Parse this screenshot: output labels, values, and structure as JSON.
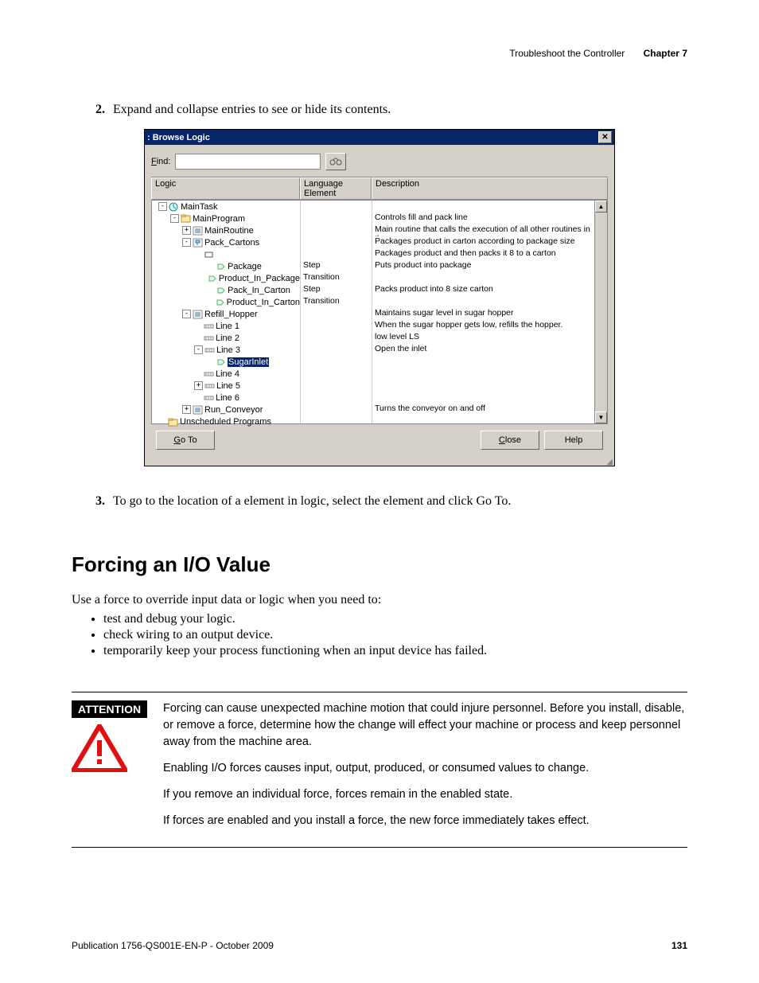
{
  "header": {
    "section": "Troubleshoot the Controller",
    "chapter": "Chapter 7"
  },
  "steps": {
    "s2_num": "2.",
    "s2_text": "Expand and collapse entries to see or hide its contents.",
    "s3_num": "3.",
    "s3_text": "To go to the location of a element in logic, select the element and click Go To."
  },
  "dialog": {
    "title": " : Browse Logic",
    "find_label": "Find:",
    "binoc_alt": "Find",
    "headers": {
      "logic": "Logic",
      "lang": "Language Element",
      "desc": "Description"
    },
    "rows": [
      {
        "indent": 0,
        "exp": "-",
        "icon": "task",
        "label": "MainTask",
        "lang": "",
        "desc": ""
      },
      {
        "indent": 1,
        "exp": "-",
        "icon": "prog",
        "label": "MainProgram",
        "lang": "",
        "desc": "Controls fill and pack line"
      },
      {
        "indent": 2,
        "exp": "+",
        "icon": "routine",
        "label": "MainRoutine",
        "lang": "",
        "desc": "Main routine that calls the execution of all other routines in th"
      },
      {
        "indent": 2,
        "exp": "-",
        "icon": "sfc",
        "label": "Pack_Cartons",
        "lang": "",
        "desc": "Packages product in carton according to package size"
      },
      {
        "indent": 3,
        "exp": "",
        "icon": "sfcbox",
        "label": "",
        "lang": "",
        "desc": "Packages product and then packs it 8 to a carton"
      },
      {
        "indent": 4,
        "exp": "",
        "icon": "step",
        "label": "Package",
        "lang": "Step",
        "desc": "Puts product into package"
      },
      {
        "indent": 4,
        "exp": "",
        "icon": "step",
        "label": "Product_In_Package",
        "lang": "Transition",
        "desc": ""
      },
      {
        "indent": 4,
        "exp": "",
        "icon": "step",
        "label": "Pack_In_Carton",
        "lang": "Step",
        "desc": "Packs product into 8 size carton"
      },
      {
        "indent": 4,
        "exp": "",
        "icon": "step",
        "label": "Product_In_Carton",
        "lang": "Transition",
        "desc": ""
      },
      {
        "indent": 2,
        "exp": "-",
        "icon": "routine",
        "label": "Refill_Hopper",
        "lang": "",
        "desc": "Maintains sugar level in sugar hopper"
      },
      {
        "indent": 3,
        "exp": "",
        "icon": "rung",
        "label": "Line 1",
        "lang": "",
        "desc": "When the sugar hopper gets low, refills the hopper."
      },
      {
        "indent": 3,
        "exp": "",
        "icon": "rung",
        "label": "Line 2",
        "lang": "",
        "desc": "low level LS"
      },
      {
        "indent": 3,
        "exp": "-",
        "icon": "rung",
        "label": "Line 3",
        "lang": "",
        "desc": "Open the inlet"
      },
      {
        "indent": 4,
        "exp": "",
        "icon": "step",
        "label": "SugarInlet",
        "lang": "",
        "desc": "",
        "selected": true
      },
      {
        "indent": 3,
        "exp": "",
        "icon": "rung",
        "label": "Line 4",
        "lang": "",
        "desc": ""
      },
      {
        "indent": 3,
        "exp": "+",
        "icon": "rung",
        "label": "Line 5",
        "lang": "",
        "desc": ""
      },
      {
        "indent": 3,
        "exp": "",
        "icon": "rung",
        "label": "Line 6",
        "lang": "",
        "desc": ""
      },
      {
        "indent": 2,
        "exp": "+",
        "icon": "routine",
        "label": "Run_Conveyor",
        "lang": "",
        "desc": "Turns the conveyor on and off"
      },
      {
        "indent": 0,
        "exp": "",
        "icon": "folder",
        "label": "Unscheduled Programs",
        "lang": "",
        "desc": ""
      }
    ],
    "buttons": {
      "goto": "Go To",
      "close": "Close",
      "help": "Help"
    }
  },
  "section_title": "Forcing an I/O Value",
  "intro": "Use a force to override input data or logic when you need to:",
  "bullets": [
    "test and debug your logic.",
    "check wiring to an output device.",
    "temporarily keep your process functioning when an input device has failed."
  ],
  "attention": {
    "label": "ATTENTION",
    "p1": "Forcing can cause unexpected machine motion that could injure personnel. Before you install, disable, or remove a force, determine how the change will effect your machine or process and keep personnel away from the machine area.",
    "p2": "Enabling I/O forces causes input, output, produced, or consumed values to change.",
    "p3": "If you remove an individual force, forces remain in the enabled state.",
    "p4": "If forces are enabled and you install a force, the new force immediately takes effect."
  },
  "footer": {
    "pub": "Publication 1756-QS001E-EN-P - October 2009",
    "page": "131"
  }
}
